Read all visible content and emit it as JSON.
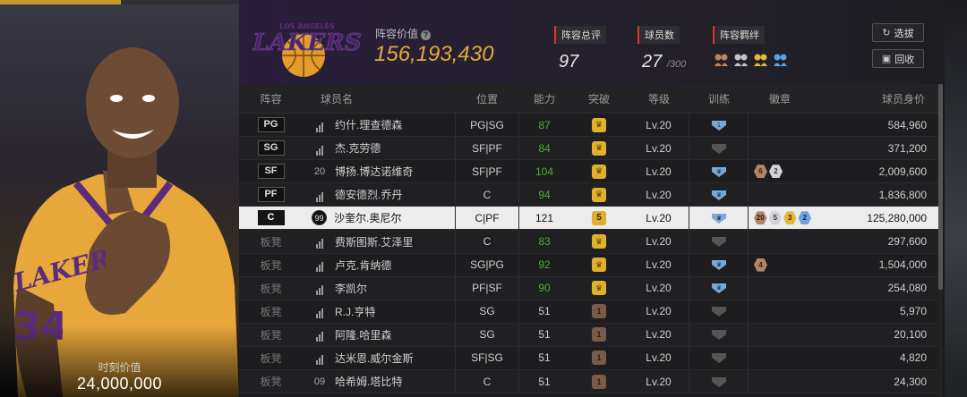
{
  "left_panel": {
    "moment_value_label": "时刻价值",
    "moment_value": "24,000,000",
    "jersey_text": "LAKERS",
    "jersey_number": "34"
  },
  "header": {
    "team_logo_text": "LAKERS",
    "team_logo_subtext": "LOS ANGELES",
    "lineup_value_label": "阵容价值",
    "lineup_value": "156,193,430",
    "rating_label": "阵容总评",
    "rating_value": "97",
    "player_count_label": "球员数",
    "player_count": "27",
    "player_count_max": "/300",
    "combo_label": "阵容羁绊",
    "select_button": "选拔",
    "recycle_button": "回收"
  },
  "table": {
    "headers": {
      "position": "阵容",
      "name": "球员名",
      "pos": "位置",
      "ability": "能力",
      "breakthrough": "突破",
      "level": "等级",
      "training": "训练",
      "badges": "徽章",
      "value": "球员身价"
    },
    "rows": [
      {
        "slot": "PG",
        "jersey": "",
        "name": "约什.理查德森",
        "pos": "PG|SG",
        "ability": "87",
        "brk": "",
        "level": "Lv.20",
        "train": "1",
        "badges": [],
        "value": "584,960"
      },
      {
        "slot": "SG",
        "jersey": "",
        "name": "杰.克劳德",
        "pos": "SF|PF",
        "ability": "84",
        "brk": "",
        "level": "Lv.20",
        "train": "",
        "badges": [],
        "value": "371,200"
      },
      {
        "slot": "SF",
        "jersey": "20",
        "name": "博扬.博达诺维奇",
        "pos": "SF|PF",
        "ability": "104",
        "brk": "",
        "level": "Lv.20",
        "train": "",
        "badges": [
          "6",
          "2"
        ],
        "value": "2,009,600"
      },
      {
        "slot": "PF",
        "jersey": "",
        "name": "德安德烈.乔丹",
        "pos": "C",
        "ability": "94",
        "brk": "",
        "level": "Lv.20",
        "train": "",
        "badges": [],
        "value": "1,836,800"
      },
      {
        "slot": "C",
        "jersey": "99",
        "name": "沙奎尔.奥尼尔",
        "pos": "C|PF",
        "ability": "121",
        "brk": "5",
        "level": "Lv.20",
        "train": "",
        "badges": [
          "20",
          "5",
          "3",
          "2"
        ],
        "value": "125,280,000"
      },
      {
        "slot": "板凳",
        "jersey": "",
        "name": "费斯图斯.艾泽里",
        "pos": "C",
        "ability": "83",
        "brk": "",
        "level": "Lv.20",
        "train": "",
        "badges": [],
        "value": "297,600"
      },
      {
        "slot": "板凳",
        "jersey": "",
        "name": "卢克.肯纳德",
        "pos": "SG|PG",
        "ability": "92",
        "brk": "",
        "level": "Lv.20",
        "train": "",
        "badges": [
          "4"
        ],
        "value": "1,504,000"
      },
      {
        "slot": "板凳",
        "jersey": "",
        "name": "李凯尔",
        "pos": "PF|SF",
        "ability": "90",
        "brk": "",
        "level": "Lv.20",
        "train": "",
        "badges": [],
        "value": "254,080"
      },
      {
        "slot": "板凳",
        "jersey": "",
        "name": "R.J.亨特",
        "pos": "SG",
        "ability": "51",
        "brk": "1",
        "level": "Lv.20",
        "train": "",
        "badges": [],
        "value": "5,970"
      },
      {
        "slot": "板凳",
        "jersey": "",
        "name": "阿隆.哈里森",
        "pos": "SG",
        "ability": "51",
        "brk": "1",
        "level": "Lv.20",
        "train": "",
        "badges": [],
        "value": "20,100"
      },
      {
        "slot": "板凳",
        "jersey": "",
        "name": "达米恩.威尔金斯",
        "pos": "SF|SG",
        "ability": "51",
        "brk": "1",
        "level": "Lv.20",
        "train": "",
        "badges": [],
        "value": "4,820"
      },
      {
        "slot": "板凳",
        "jersey": "09",
        "name": "哈希姆.塔比特",
        "pos": "C",
        "ability": "51",
        "brk": "1",
        "level": "Lv.20",
        "train": "",
        "badges": [],
        "value": "24,300"
      }
    ]
  }
}
